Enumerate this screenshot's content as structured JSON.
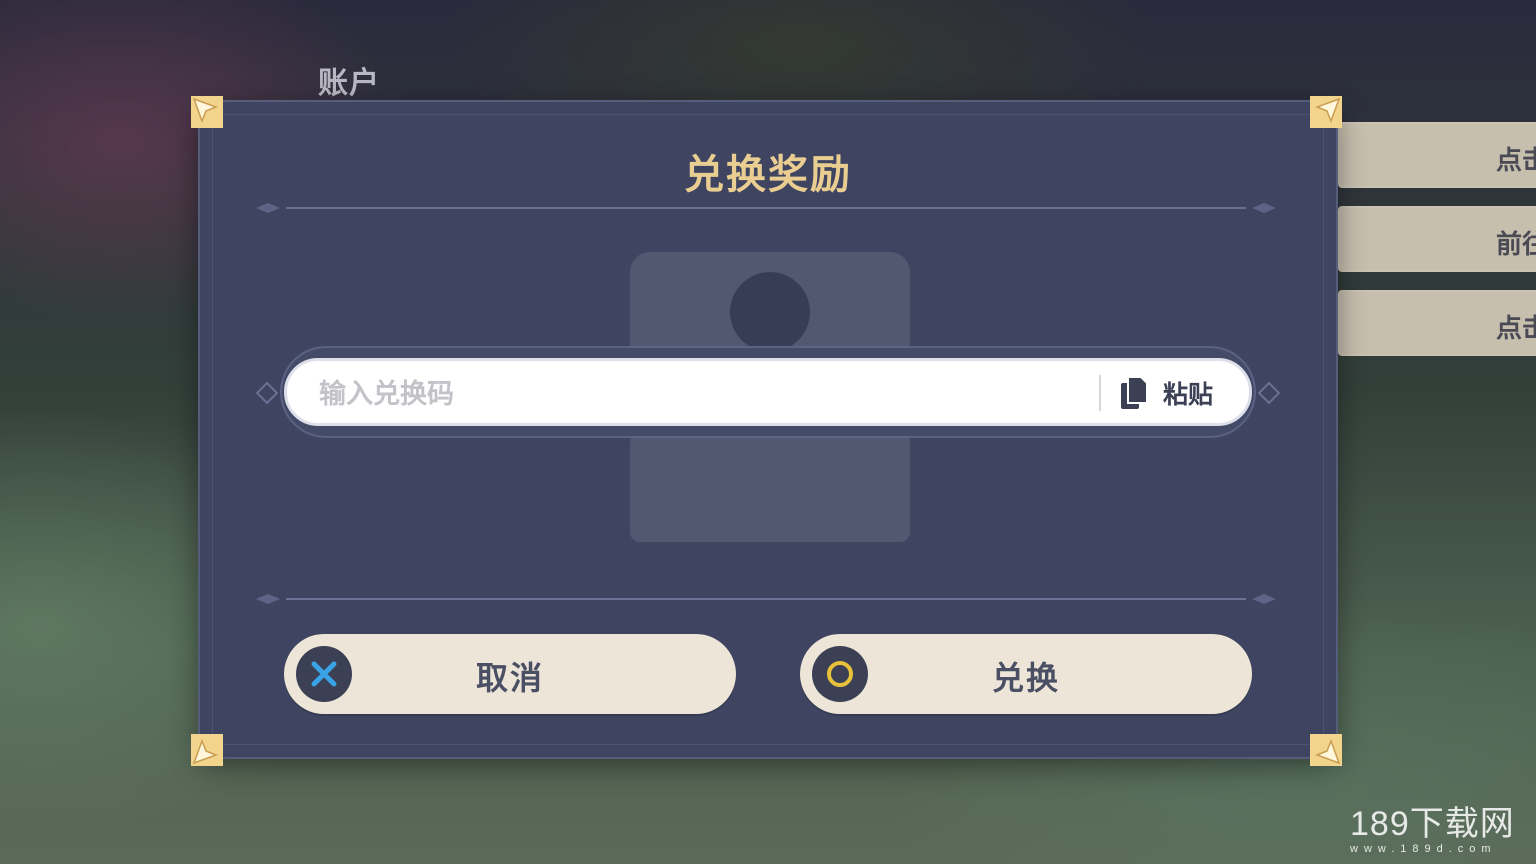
{
  "background": {
    "account_label": "账户",
    "side_panels": [
      {
        "label": "点击"
      },
      {
        "label": "前往"
      },
      {
        "label": "点击"
      }
    ]
  },
  "dialog": {
    "title": "兑换奖励",
    "input": {
      "placeholder": "输入兑换码",
      "value": ""
    },
    "paste_label": "粘贴",
    "cancel_label": "取消",
    "confirm_label": "兑换"
  },
  "watermark": {
    "text": "189下载网",
    "url": "www.189d.com"
  },
  "colors": {
    "dialog_bg": "#3f4561",
    "title_gold": "#e9cd91",
    "button_bg": "#ece5d8",
    "cancel_icon_x": "#3aa3e6",
    "confirm_icon_ring": "#e6c13a"
  },
  "icons": {
    "paste": "document-copy-icon",
    "cancel": "x-icon",
    "confirm": "circle-icon",
    "corner": "star-corner-icon"
  }
}
